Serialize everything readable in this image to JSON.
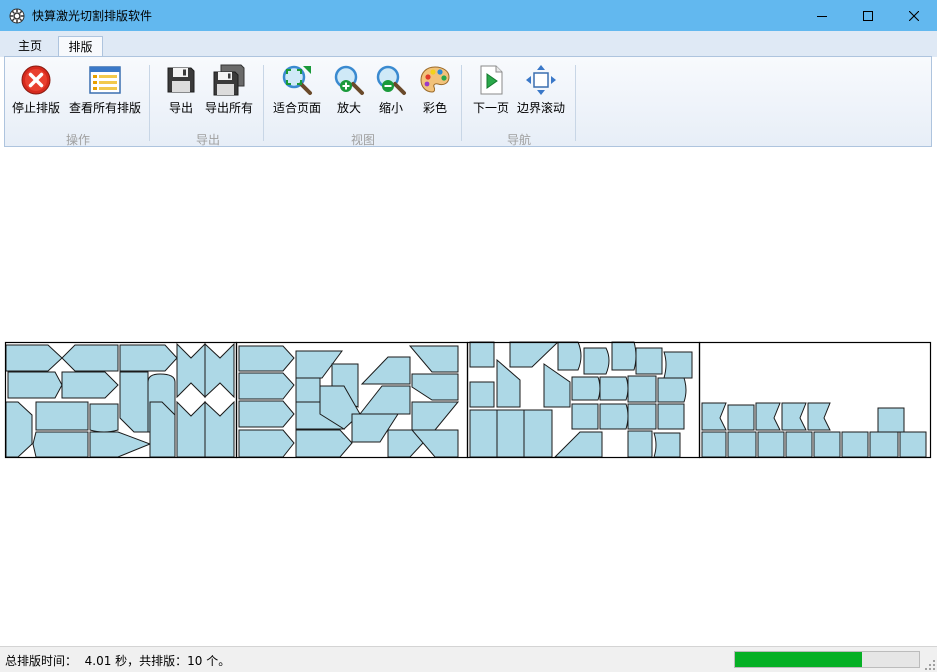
{
  "window": {
    "title": "快算激光切割排版软件",
    "icon": "app-gear-icon",
    "controls": [
      "minimize-icon",
      "maximize-icon",
      "close-icon"
    ]
  },
  "tabs": [
    {
      "label": "主页",
      "active": false
    },
    {
      "label": "排版",
      "active": true
    }
  ],
  "ribbon": {
    "groups": [
      {
        "label": "操作",
        "buttons": [
          {
            "label": "停止排版",
            "icon": "stop-icon"
          },
          {
            "label": "查看所有排版",
            "icon": "layout-list-icon"
          }
        ]
      },
      {
        "label": "导出",
        "buttons": [
          {
            "label": "导出",
            "icon": "save-disk-icon"
          },
          {
            "label": "导出所有",
            "icon": "save-all-icon"
          }
        ]
      },
      {
        "label": "视图",
        "buttons": [
          {
            "label": "适合页面",
            "icon": "zoom-fit-icon"
          },
          {
            "label": "放大",
            "icon": "zoom-in-icon"
          },
          {
            "label": "缩小",
            "icon": "zoom-out-icon"
          },
          {
            "label": "彩色",
            "icon": "color-palette-icon"
          }
        ]
      },
      {
        "label": "导航",
        "buttons": [
          {
            "label": "下一页",
            "icon": "next-page-icon"
          },
          {
            "label": "边界滚动",
            "icon": "border-scroll-icon"
          }
        ]
      }
    ]
  },
  "colors": {
    "titlebar": "#62b8ef",
    "part_fill": "#add8e6",
    "progress": "#06b025"
  },
  "status": {
    "text": "总排版时间：  4.01 秒，共排版：10 个。",
    "progress": 0.69
  }
}
